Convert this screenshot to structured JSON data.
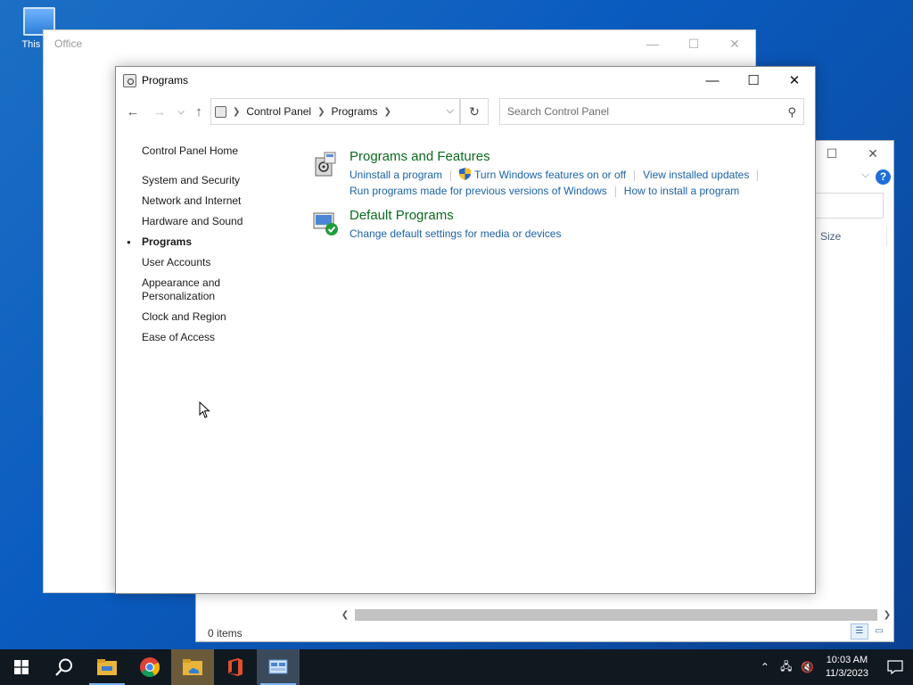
{
  "desktop": {
    "icon_label": "This PC"
  },
  "explorer_bg": {
    "column_size": "Size",
    "status": "0 items"
  },
  "office_window": {
    "title": "Office"
  },
  "programs_window": {
    "title": "Programs",
    "breadcrumb": [
      "Control Panel",
      "Programs"
    ],
    "search_placeholder": "Search Control Panel",
    "left_nav": {
      "home": "Control Panel Home",
      "items": [
        "System and Security",
        "Network and Internet",
        "Hardware and Sound",
        "Programs",
        "User Accounts",
        "Appearance and Personalization",
        "Clock and Region",
        "Ease of Access"
      ],
      "active_index": 3
    },
    "categories": {
      "programs_features": {
        "title": "Programs and Features",
        "links": {
          "uninstall": "Uninstall a program",
          "windows_features": "Turn Windows features on or off",
          "installed_updates": "View installed updates",
          "compat": "Run programs made for previous versions of Windows",
          "how_install": "How to install a program"
        }
      },
      "default_programs": {
        "title": "Default Programs",
        "links": {
          "change_defaults": "Change default settings for media or devices"
        }
      }
    }
  },
  "taskbar": {
    "apps": [
      "start-icon",
      "search-icon",
      "file-explorer-icon",
      "chrome-icon",
      "onedrive-folder-icon",
      "office-icon",
      "control-panel-icon"
    ],
    "clock_time": "10:03 AM",
    "clock_date": "11/3/2023"
  },
  "colors": {
    "link": "#1b62a8",
    "category_title": "#0a6a1f",
    "taskbar": "#101820"
  }
}
